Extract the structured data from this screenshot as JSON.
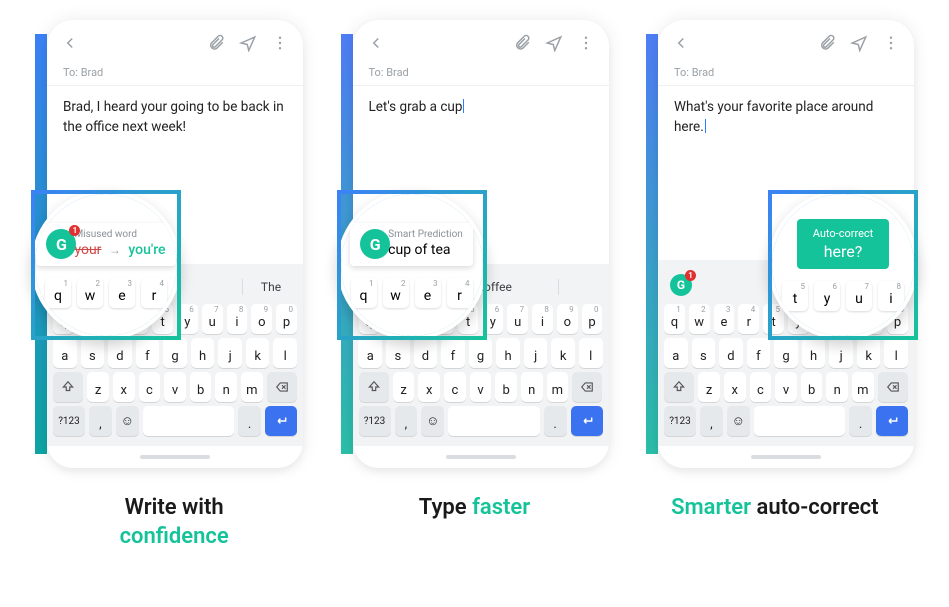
{
  "panels": [
    {
      "to": "To: Brad",
      "body": "Brad, I heard your going to be back in the office next week!",
      "suggest_right": "The",
      "lens_title": "Misused word",
      "lens_strike": "your",
      "lens_fix": "you're",
      "lens_keys": [
        "q",
        "w",
        "e",
        "r"
      ],
      "cap_line1": "Write with",
      "cap_line2": "confidence"
    },
    {
      "to": "To: Brad",
      "body": "Let's grab a cup",
      "suggest_center": "cup of coffee",
      "lens_title": "Smart Prediction",
      "lens_main": "cup of tea",
      "lens_keys": [
        "q",
        "w",
        "e",
        "r"
      ],
      "cap_a": "Type ",
      "cap_b": "faster"
    },
    {
      "to": "To: Brad",
      "body": "What's your favorite place around here.",
      "suggest_pill": "here?",
      "lens_title": "Auto-correct",
      "lens_main": "here?",
      "lens_keys": [
        "t",
        "y",
        "u",
        "i"
      ],
      "cap_a": "Smarter",
      "cap_b": " auto-correct"
    }
  ],
  "g_label": "G",
  "g_count": "1",
  "kbd": {
    "row1": [
      {
        "k": "q",
        "n": "1"
      },
      {
        "k": "w",
        "n": "2"
      },
      {
        "k": "e",
        "n": "3"
      },
      {
        "k": "r",
        "n": "4"
      },
      {
        "k": "t",
        "n": "5"
      },
      {
        "k": "y",
        "n": "6"
      },
      {
        "k": "u",
        "n": "7"
      },
      {
        "k": "i",
        "n": "8"
      },
      {
        "k": "o",
        "n": "9"
      },
      {
        "k": "p",
        "n": "0"
      }
    ],
    "row2": [
      "a",
      "s",
      "d",
      "f",
      "g",
      "h",
      "j",
      "k",
      "l"
    ],
    "row3": [
      "z",
      "x",
      "c",
      "v",
      "b",
      "n",
      "m"
    ],
    "sym": "?123",
    "comma": ",",
    "period": "."
  },
  "lens_nums": [
    "1",
    "2",
    "3",
    "4",
    "5",
    "6",
    "7",
    "8"
  ]
}
